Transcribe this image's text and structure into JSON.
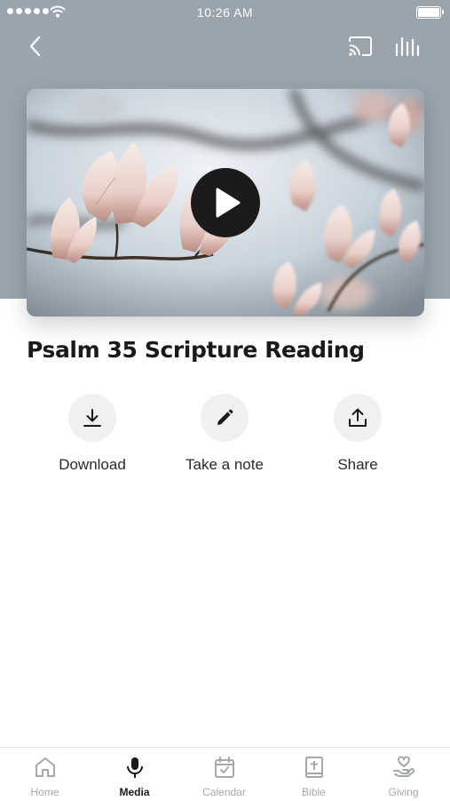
{
  "status_bar": {
    "time": "10:26 AM"
  },
  "header": {
    "back_icon": "chevron-left-icon",
    "cast_icon": "cast-icon",
    "levels_icon": "audio-levels-icon"
  },
  "media": {
    "title": "Psalm 35 Scripture Reading",
    "thumbnail": "magnolia blossoms photo",
    "play_icon": "play-icon"
  },
  "actions": [
    {
      "label": "Download",
      "icon": "download-icon"
    },
    {
      "label": "Take a note",
      "icon": "pencil-icon"
    },
    {
      "label": "Share",
      "icon": "share-icon"
    }
  ],
  "tabs": [
    {
      "label": "Home",
      "icon": "home-icon",
      "active": false
    },
    {
      "label": "Media",
      "icon": "microphone-icon",
      "active": true
    },
    {
      "label": "Calendar",
      "icon": "calendar-icon",
      "active": false
    },
    {
      "label": "Bible",
      "icon": "bible-icon",
      "active": false
    },
    {
      "label": "Giving",
      "icon": "giving-hand-heart-icon",
      "active": false
    }
  ],
  "colors": {
    "header_background": "#9aa4ad",
    "action_circle": "#eef0f2",
    "tab_active": "#1a1a1a",
    "tab_inactive": "#a3a8ae"
  }
}
